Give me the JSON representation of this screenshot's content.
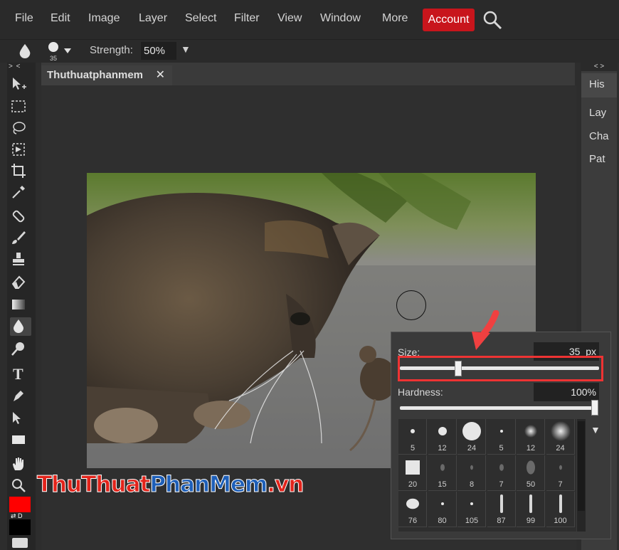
{
  "menubar": {
    "items": [
      "File",
      "Edit",
      "Image",
      "Layer",
      "Select",
      "Filter",
      "View",
      "Window",
      "More"
    ],
    "account": "Account",
    "colors": {
      "account_bg": "#c8151c"
    }
  },
  "options": {
    "brush_size": "35",
    "strength_label": "Strength:",
    "strength_value": "50%"
  },
  "toolbar": {
    "collapse": "> <",
    "tools": [
      "move-icon",
      "marquee-icon",
      "lasso-icon",
      "wand-icon",
      "crop-icon",
      "eyedropper-icon",
      "heal-icon",
      "brush-icon",
      "stamp-icon",
      "eraser-icon",
      "gradient-icon",
      "drop-icon",
      "sponge-icon",
      "type-icon",
      "pen-icon",
      "path-select-icon",
      "shape-icon",
      "hand-icon",
      "zoom-icon"
    ],
    "active_tool": "drop-icon",
    "fg_color": "#ff0000",
    "bg_color": "#000000",
    "swap_label": "⇄ D"
  },
  "document": {
    "tab_title": "Thuthuatphanmem",
    "tab_close": "✕"
  },
  "right_panel": {
    "collapse": "< >",
    "items": [
      "His",
      "Lay",
      "Cha",
      "Pat"
    ]
  },
  "brush_popup": {
    "size_label": "Size:",
    "size_value": "35",
    "size_unit": "px",
    "size_fraction": 0.25,
    "hardness_label": "Hardness:",
    "hardness_value": "100%",
    "hardness_fraction": 1.0,
    "presets": [
      {
        "label": "5"
      },
      {
        "label": "12"
      },
      {
        "label": "24"
      },
      {
        "label": "5"
      },
      {
        "label": "12"
      },
      {
        "label": "24"
      },
      {
        "label": "20"
      },
      {
        "label": "15"
      },
      {
        "label": "8"
      },
      {
        "label": "7"
      },
      {
        "label": "50"
      },
      {
        "label": "7"
      },
      {
        "label": "76"
      },
      {
        "label": "80"
      },
      {
        "label": "105"
      },
      {
        "label": "87"
      },
      {
        "label": "99"
      },
      {
        "label": "100"
      }
    ]
  },
  "watermark": {
    "part1": "ThuThuat",
    "part2": "PhanMem",
    "part3": ".vn"
  }
}
